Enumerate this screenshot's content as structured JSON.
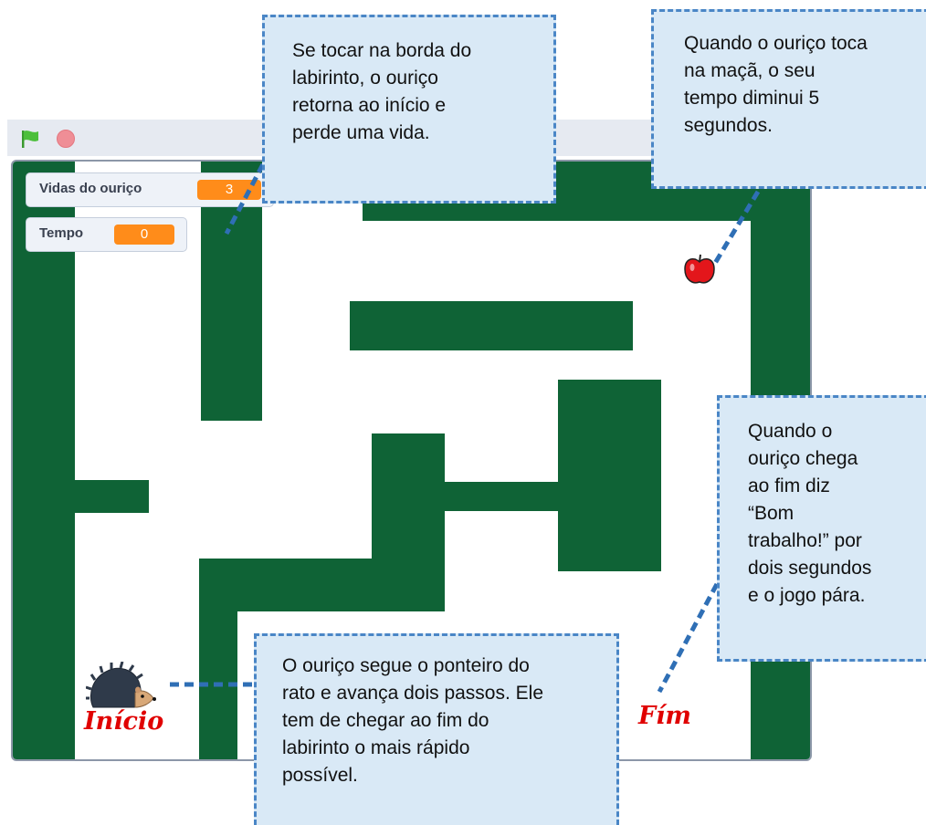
{
  "toolbar": {
    "green_flag_icon": "green-flag-icon",
    "stop_icon": "stop-icon"
  },
  "monitors": {
    "lives": {
      "label": "Vidas do ouriço",
      "value": "3"
    },
    "time": {
      "label": "Tempo",
      "value": "0"
    }
  },
  "sprites": {
    "start_label": "Início",
    "end_label": "Fím",
    "hedgehog_icon": "hedgehog-icon",
    "apple_icon": "apple-icon"
  },
  "callouts": {
    "border": [
      "Se tocar na borda do",
      "labirinto, o ouriço",
      "retorna ao início e",
      "perde uma vida."
    ],
    "apple": [
      "Quando o ouriço toca",
      "na maçã, o seu",
      "tempo diminui 5",
      "segundos."
    ],
    "end": [
      "Quando o",
      "ouriço chega",
      "ao fim diz",
      "“Bom",
      "trabalho!” por",
      "dois segundos",
      "e o jogo pára."
    ],
    "mouse": [
      "O ouriço segue o ponteiro do",
      "rato e avança dois passos. Ele",
      "tem de chegar ao fim do",
      "labirinto o mais rápido",
      "possível."
    ]
  },
  "colors": {
    "maze_wall": "#0f6336",
    "callout_fill": "#d9e9f6",
    "callout_border": "#4a86c6",
    "monitor_value": "#ff8c1a",
    "label_red": "#e00000"
  }
}
